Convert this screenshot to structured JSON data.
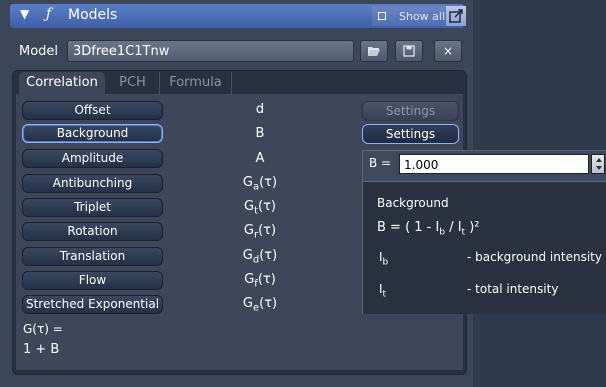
{
  "titlebar": {
    "title": "Models",
    "show_all_label": "Show all"
  },
  "model": {
    "label": "Model",
    "value": "3Dfree1C1Tnw",
    "close_glyph": "×"
  },
  "tabs": [
    {
      "label": "Correlation"
    },
    {
      "label": "PCH"
    },
    {
      "label": "Formula"
    }
  ],
  "rows": [
    {
      "button": "Offset",
      "symbol": "d"
    },
    {
      "button": "Background",
      "symbol": "B"
    },
    {
      "button": "Amplitude",
      "symbol": "A"
    },
    {
      "button": "Antibunching",
      "symbol": "G",
      "symbol_sub": "a",
      "symbol_tail": "(τ)"
    },
    {
      "button": "Triplet",
      "symbol": "G",
      "symbol_sub": "t",
      "symbol_tail": "(τ)"
    },
    {
      "button": "Rotation",
      "symbol": "G",
      "symbol_sub": "r",
      "symbol_tail": "(τ)"
    },
    {
      "button": "Translation",
      "symbol": "G",
      "symbol_sub": "d",
      "symbol_tail": "(τ)"
    },
    {
      "button": "Flow",
      "symbol": "G",
      "symbol_sub": "f",
      "symbol_tail": "(τ)"
    },
    {
      "button": "Stretched Exponential",
      "symbol": "G",
      "symbol_sub": "e",
      "symbol_tail": "(τ)"
    }
  ],
  "settings": {
    "label_disabled": "Settings",
    "label_enabled": "Settings"
  },
  "result": {
    "line1": "G(τ) =",
    "line2": "1 + B"
  },
  "popup": {
    "field_label": "B =",
    "field_value": "1.000",
    "title": "Background",
    "formula_lead": "B   = ( 1 - I",
    "formula_sub1": "b",
    "formula_mid": " / I",
    "formula_sub2": "t",
    "formula_end": " )²",
    "term1": "I",
    "term1_sub": "b",
    "term1_desc": "- background intensity",
    "term2": "I",
    "term2_sub": "t",
    "term2_desc": "- total intensity"
  }
}
